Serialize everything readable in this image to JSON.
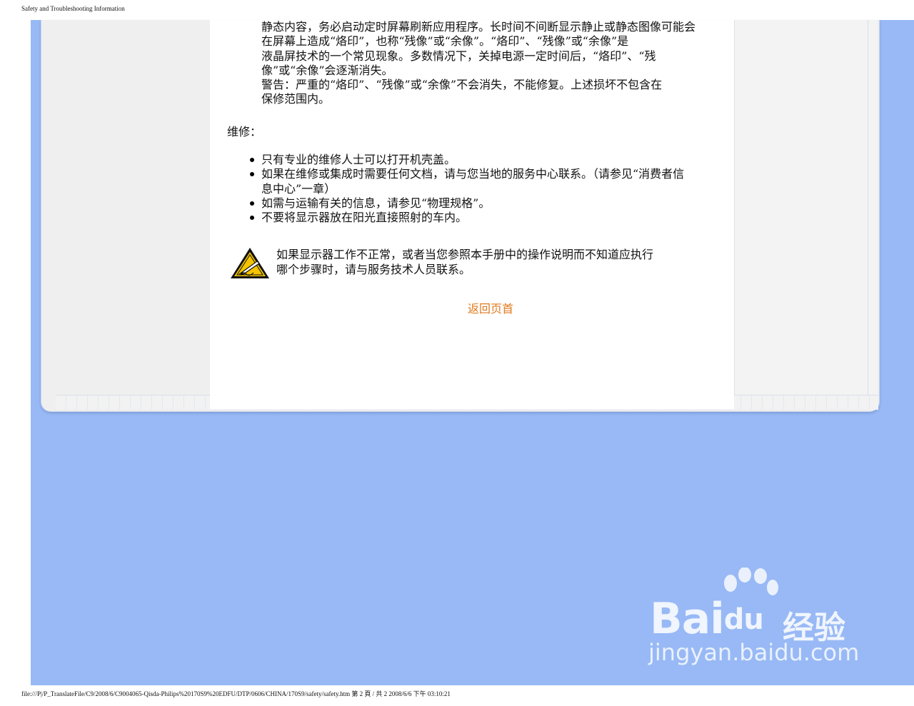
{
  "header": {
    "title": "Safety and Troubleshooting Information"
  },
  "intro": {
    "lines": [
      "静态内容，务必启动定时屏幕刷新应用程序。长时间不间断显示静止或静态图像可能会",
      "在屏幕上造成“烙印”，也称“残像”或“余像”。“烙印”、“残像”或“余像”是",
      "液晶屏技术的一个常见现象。多数情况下，关掉电源一定时间后，“烙印”、“残",
      "像”或“余像”会逐渐消失。"
    ],
    "warning_lines": [
      "警告：严重的“烙印”、“残像”或“余像”不会消失，不能修复。上述损坏不包含在",
      "保修范围内。"
    ]
  },
  "service": {
    "heading": "维修：",
    "items": [
      [
        "只有专业的维修人士可以打开机壳盖。"
      ],
      [
        "如果在维修或集成时需要任何文档，请与您当地的服务中心联系。（请参见“消费者信",
        "息中心”一章）"
      ],
      [
        "如需与运输有关的信息，请参见“物理规格”。"
      ],
      [
        "不要将显示器放在阳光直接照射的车内。"
      ]
    ]
  },
  "notice": {
    "icon": "warning-pen-icon",
    "lines": [
      "如果显示器工作不正常，或者当您参照本手册中的操作说明而不知道应执行",
      "哪个步骤时，请与服务技术人员联系。"
    ]
  },
  "back_to_top": "返回页首",
  "footer": {
    "text": "file:///P|/P_TranslateFile/C9/2008/6/C9004065-Qisda-Philips%20170S9%20EDFU/DTP/0606/CHINA/170S9/safety/safety.htm 第 2 頁 / 共 2 2008/6/6 下午 03:10:21"
  },
  "watermark": {
    "brand": "Bai",
    "brand_du": "du",
    "brand_cn": "经验",
    "url": "jingyan.baidu.com"
  },
  "colors": {
    "page_background": "#98b9f5",
    "link": "#e07a1f",
    "frame": "#efefef"
  }
}
